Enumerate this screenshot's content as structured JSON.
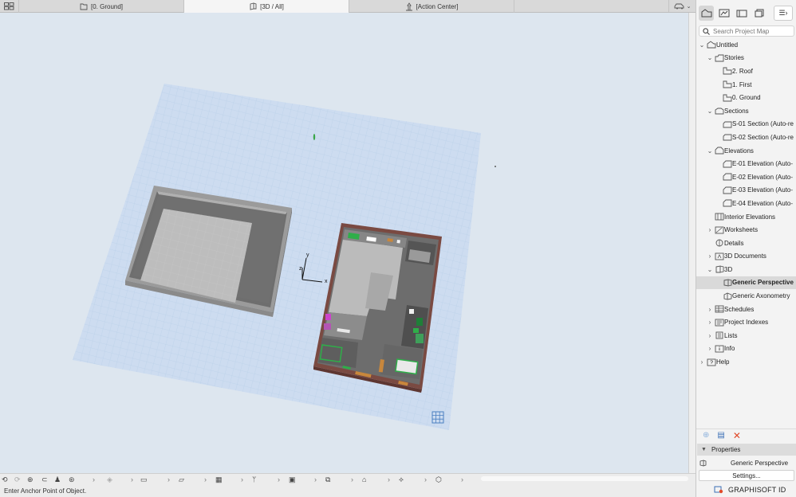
{
  "tabs": [
    {
      "label": "[0. Ground]",
      "icon": "floor-plan-icon"
    },
    {
      "label": "[3D / All]",
      "icon": "3d-view-icon"
    },
    {
      "label": "[Action Center]",
      "icon": "action-center-icon"
    }
  ],
  "active_tab": "[3D / All]",
  "viewport": {
    "axis_x_label": "x",
    "axis_y_label": "y",
    "axis_z_label": "z"
  },
  "status": {
    "message": "Enter Anchor Point of Object."
  },
  "navigator": {
    "search_placeholder": "Search Project Map",
    "items": [
      {
        "label": "Untitled",
        "level": 0,
        "chevron": "v",
        "icon": "project-icon"
      },
      {
        "label": "Stories",
        "level": 1,
        "chevron": "v",
        "icon": "stories-icon"
      },
      {
        "label": "2. Roof",
        "level": 2,
        "chevron": "",
        "icon": "story-icon"
      },
      {
        "label": "1. First",
        "level": 2,
        "chevron": "",
        "icon": "story-icon"
      },
      {
        "label": "0. Ground",
        "level": 2,
        "chevron": "",
        "icon": "story-icon"
      },
      {
        "label": "Sections",
        "level": 1,
        "chevron": "v",
        "icon": "sections-icon"
      },
      {
        "label": "S-01 Section (Auto-re",
        "level": 2,
        "chevron": "",
        "icon": "section-icon"
      },
      {
        "label": "S-02 Section (Auto-re",
        "level": 2,
        "chevron": "",
        "icon": "section-icon"
      },
      {
        "label": "Elevations",
        "level": 1,
        "chevron": "v",
        "icon": "elevations-icon"
      },
      {
        "label": "E-01 Elevation (Auto-",
        "level": 2,
        "chevron": "",
        "icon": "elevation-icon"
      },
      {
        "label": "E-02 Elevation (Auto-",
        "level": 2,
        "chevron": "",
        "icon": "elevation-icon"
      },
      {
        "label": "E-03 Elevation (Auto-",
        "level": 2,
        "chevron": "",
        "icon": "elevation-icon"
      },
      {
        "label": "E-04 Elevation (Auto-",
        "level": 2,
        "chevron": "",
        "icon": "elevation-icon"
      },
      {
        "label": "Interior Elevations",
        "level": 1,
        "chevron": "",
        "icon": "interior-elevations-icon"
      },
      {
        "label": "Worksheets",
        "level": 1,
        "chevron": ">",
        "icon": "worksheets-icon"
      },
      {
        "label": "Details",
        "level": 1,
        "chevron": "",
        "icon": "details-icon"
      },
      {
        "label": "3D Documents",
        "level": 1,
        "chevron": ">",
        "icon": "3d-documents-icon"
      },
      {
        "label": "3D",
        "level": 1,
        "chevron": "v",
        "icon": "3d-icon"
      },
      {
        "label": "Generic Perspective",
        "level": 2,
        "chevron": "",
        "icon": "perspective-icon",
        "selected": true
      },
      {
        "label": "Generic Axonometry",
        "level": 2,
        "chevron": "",
        "icon": "axonometry-icon"
      },
      {
        "label": "Schedules",
        "level": 1,
        "chevron": ">",
        "icon": "schedules-icon"
      },
      {
        "label": "Project Indexes",
        "level": 1,
        "chevron": ">",
        "icon": "project-indexes-icon"
      },
      {
        "label": "Lists",
        "level": 1,
        "chevron": ">",
        "icon": "lists-icon"
      },
      {
        "label": "Info",
        "level": 1,
        "chevron": ">",
        "icon": "info-icon"
      },
      {
        "label": "Help",
        "level": 0,
        "chevron": ">",
        "icon": "help-icon"
      }
    ]
  },
  "properties": {
    "header": "Properties",
    "view_name": "Generic Perspective",
    "settings_label": "Settings..."
  },
  "brand": "GRAPHISOFT ID",
  "colors": {
    "viewport_bg": "#dde6ef",
    "grid_plane": "#c7d8ee",
    "selected_row": "#d9d9d9",
    "delete_red": "#e04a2a"
  }
}
